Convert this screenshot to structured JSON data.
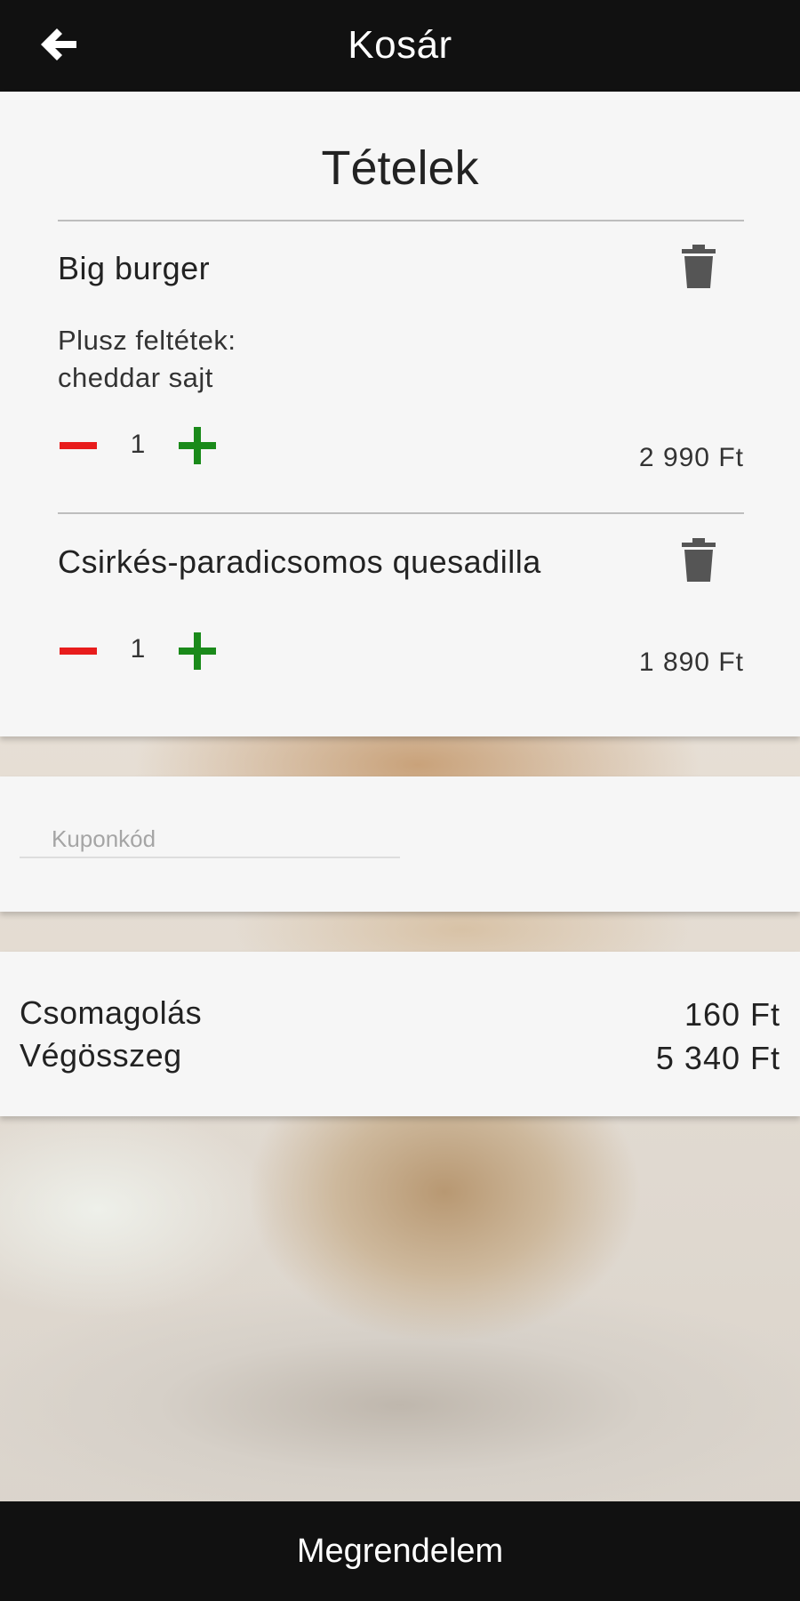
{
  "header": {
    "title": "Kosár",
    "back_icon": "arrow-left-icon"
  },
  "items_section": {
    "title": "Tételek",
    "items": [
      {
        "name": "Big burger",
        "extras_label": "Plusz feltétek:",
        "extras_value": "cheddar sajt",
        "quantity": "1",
        "price": "2 990 Ft"
      },
      {
        "name": "Csirkés-paradicsomos quesadilla",
        "quantity": "1",
        "price": "1 890 Ft"
      }
    ]
  },
  "coupon": {
    "placeholder": "Kuponkód",
    "value": ""
  },
  "totals": {
    "packaging_label": "Csomagolás",
    "packaging_value": "160 Ft",
    "total_label": "Végösszeg",
    "total_value": "5 340 Ft"
  },
  "footer": {
    "order_button": "Megrendelem"
  },
  "colors": {
    "bar": "#111111",
    "card": "#f6f6f6",
    "minus": "#e81c1c",
    "plus": "#1a8a1a",
    "trash": "#555555"
  }
}
